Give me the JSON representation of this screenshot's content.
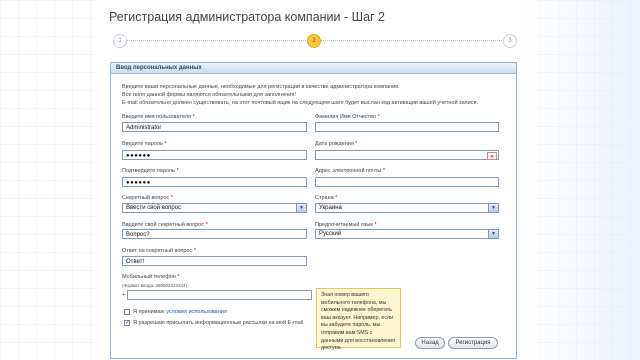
{
  "page": {
    "title": "Регистрация администратора компании - Шаг 2",
    "steps": [
      {
        "label": "1",
        "active": false
      },
      {
        "label": "2",
        "active": true
      },
      {
        "label": "3",
        "active": false
      }
    ]
  },
  "panel": {
    "header": "Ввод персональных данных",
    "intro": [
      "Введите ваши персональные данные, необходимые для регистрации в качестве администратора компании.",
      "Все поля данной формы являются обязательными для заполнения!",
      "E-mail обязательно должен существовать, на этот почтовый ящик на следующем шаге будет выслан код активации вашей учетной записи."
    ]
  },
  "form": {
    "username": {
      "label": "Введите имя пользователя",
      "value": "Administrator"
    },
    "fullname": {
      "label": "Фамилия Имя Отчество",
      "value": ""
    },
    "password": {
      "label": "Введите пароль",
      "value": "●●●●●●"
    },
    "birthdate": {
      "label": "Дата рождения",
      "value": ""
    },
    "password_confirm": {
      "label": "Подтвердите пароль",
      "value": "●●●●●●"
    },
    "email": {
      "label": "Адрес электронной почты",
      "value": ""
    },
    "secret_question": {
      "label": "Секретный вопрос",
      "value": "Ввести свой вопрос"
    },
    "country": {
      "label": "Страна",
      "value": "Украина"
    },
    "own_question": {
      "label": "Введите свой секретный вопрос",
      "value": "Вопрос?"
    },
    "language": {
      "label": "Предпочитаемый язык",
      "value": "Русский"
    },
    "answer": {
      "label": "Ответ на секретный вопрос",
      "value": "Ответ!"
    },
    "phone": {
      "label": "Мобильный телефон",
      "hint": "(Формат ввода: 380502223344)",
      "prefix": "+",
      "value": ""
    },
    "required_mark": "*"
  },
  "tooltip": {
    "text": "Зная номер вашего мобильного телефона, мы сможем надежнее оберегать ваш аккаунт. Например, если вы забудете пароль, мы отправим вам SMS с данными для восстановления доступа."
  },
  "checkboxes": {
    "terms": {
      "prefix": "Я принимаю ",
      "link": "условия использования",
      "checked": false
    },
    "newsletter": {
      "label": "Я разрешаю присылать информационные рассылки на мой E-mail",
      "checked": true
    }
  },
  "buttons": {
    "back": "Назад",
    "register": "Регистрация"
  },
  "icons": {
    "calendar": "calendar-icon",
    "dropdown": "chevron-down-icon",
    "check": "checkmark-icon"
  }
}
